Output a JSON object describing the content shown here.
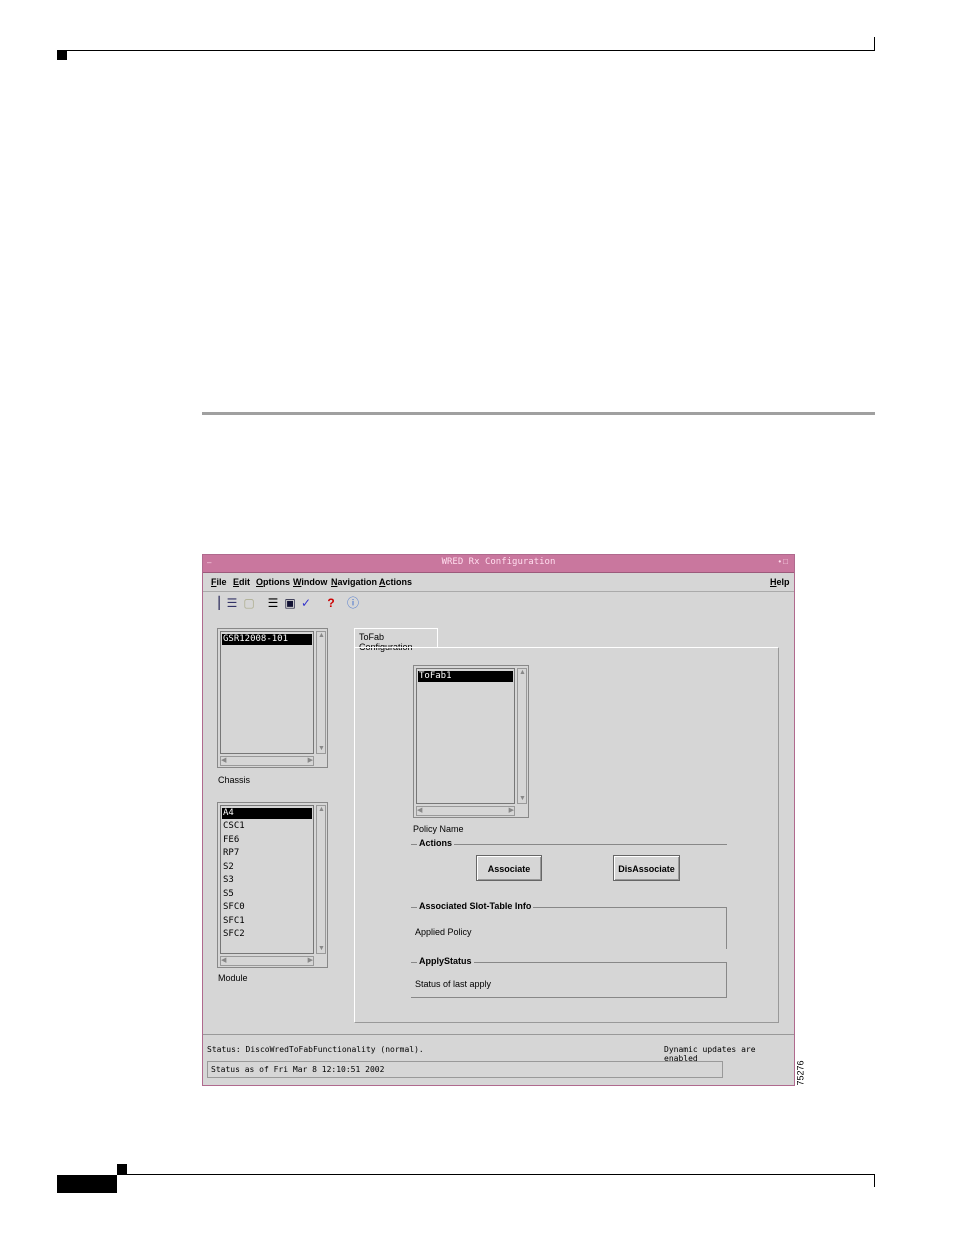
{
  "window": {
    "title": "WRED Rx Configuration",
    "menu": [
      "File",
      "Edit",
      "Options",
      "Window",
      "Navigation",
      "Actions"
    ],
    "help_menu": "Help"
  },
  "chassis": {
    "items": [
      "GSR12008-101"
    ],
    "label": "Chassis"
  },
  "module": {
    "items": [
      "A4",
      "CSC1",
      "FE6",
      "RP7",
      "S2",
      "S3",
      "S5",
      "SFC0",
      "SFC1",
      "SFC2"
    ],
    "label": "Module"
  },
  "tab": {
    "label": "ToFab Configuration"
  },
  "policy": {
    "items": [
      "ToFab1"
    ],
    "label": "Policy Name"
  },
  "actions": {
    "title": "Actions",
    "associate": "Associate",
    "disassociate": "DisAssociate"
  },
  "assoc_info": {
    "title": "Associated Slot-Table Info",
    "applied_policy": "Applied Policy"
  },
  "apply_status": {
    "title": "ApplyStatus",
    "text": "Status of last apply"
  },
  "status": {
    "message": "Status: DiscoWredToFabFunctionality (normal).",
    "dynamic": "Dynamic updates are enabled",
    "timestamp": "Status as of Fri Mar  8 12:10:51 2002"
  },
  "figure_number": "75276",
  "colors": {
    "titlebar": "#c9779e",
    "window_bg": "#d6d6d6",
    "selection": "#000000"
  }
}
